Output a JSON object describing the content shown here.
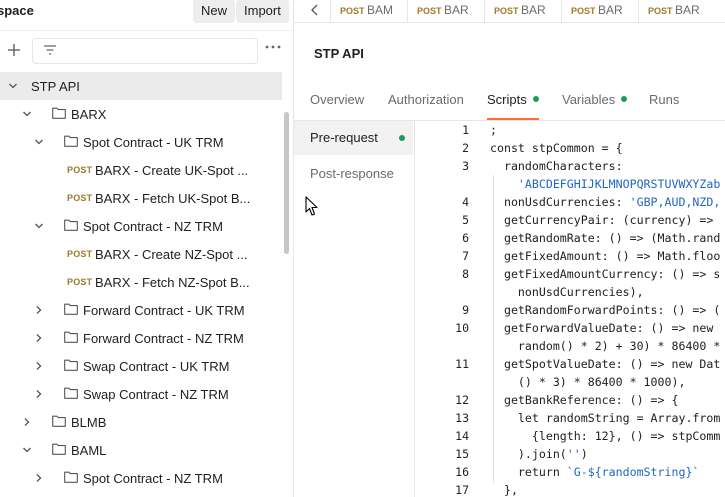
{
  "sidebar": {
    "workspace_title": "space",
    "new_label": "New",
    "import_label": "Import",
    "tree": [
      {
        "label": "STP API",
        "type": "collection",
        "expanded": true,
        "selected": true,
        "level": 0
      },
      {
        "label": "BARX",
        "type": "folder",
        "expanded": true,
        "level": 1
      },
      {
        "label": "Spot Contract - UK TRM",
        "type": "folder",
        "expanded": true,
        "level": 2
      },
      {
        "label": "BARX - Create UK-Spot ...",
        "type": "request",
        "method": "POST",
        "level": 3
      },
      {
        "label": "BARX - Fetch UK-Spot B...",
        "type": "request",
        "method": "POST",
        "level": 3
      },
      {
        "label": "Spot Contract - NZ TRM",
        "type": "folder",
        "expanded": true,
        "level": 2
      },
      {
        "label": "BARX - Create NZ-Spot ...",
        "type": "request",
        "method": "POST",
        "level": 3
      },
      {
        "label": "BARX - Fetch NZ-Spot B...",
        "type": "request",
        "method": "POST",
        "level": 3
      },
      {
        "label": "Forward Contract - UK TRM",
        "type": "folder",
        "expanded": false,
        "level": 2
      },
      {
        "label": "Forward Contract - NZ TRM",
        "type": "folder",
        "expanded": false,
        "level": 2
      },
      {
        "label": "Swap Contract - UK TRM",
        "type": "folder",
        "expanded": false,
        "level": 2
      },
      {
        "label": "Swap Contract - NZ TRM",
        "type": "folder",
        "expanded": false,
        "level": 2
      },
      {
        "label": "BLMB",
        "type": "folder",
        "expanded": false,
        "level": 1
      },
      {
        "label": "BAML",
        "type": "folder",
        "expanded": true,
        "level": 1
      },
      {
        "label": "Spot Contract - NZ TRM",
        "type": "folder",
        "expanded": false,
        "level": 2
      }
    ]
  },
  "tabs": [
    {
      "method": "POST",
      "name": "BAM"
    },
    {
      "method": "POST",
      "name": "BAR"
    },
    {
      "method": "POST",
      "name": "BAR"
    },
    {
      "method": "POST",
      "name": "BAR"
    },
    {
      "method": "POST",
      "name": "BAR"
    }
  ],
  "request": {
    "title": "STP API",
    "subtabs": [
      {
        "label": "Overview",
        "dot": false,
        "active": false
      },
      {
        "label": "Authorization",
        "dot": false,
        "active": false
      },
      {
        "label": "Scripts",
        "dot": true,
        "active": true
      },
      {
        "label": "Variables",
        "dot": true,
        "active": false
      },
      {
        "label": "Runs",
        "dot": false,
        "active": false
      }
    ],
    "script_nav": [
      {
        "label": "Pre-request",
        "dot": true,
        "active": true
      },
      {
        "label": "Post-response",
        "dot": false,
        "active": false
      }
    ]
  },
  "editor": {
    "lines": [
      {
        "n": "1",
        "text": ";"
      },
      {
        "n": "2",
        "text": "const stpCommon = {"
      },
      {
        "n": "3",
        "text": "  randomCharacters:"
      },
      {
        "n": "",
        "text": "    'ABCDEFGHIJKLMNOPQRSTUVWXYZab"
      },
      {
        "n": "4",
        "text": "  nonUsdCurrencies: 'GBP,AUD,NZD,"
      },
      {
        "n": "5",
        "text": "  getCurrencyPair: (currency) =>"
      },
      {
        "n": "6",
        "text": "  getRandomRate: () => (Math.rand"
      },
      {
        "n": "7",
        "text": "  getFixedAmount: () => Math.floo"
      },
      {
        "n": "8",
        "text": "  getFixedAmountCurrency: () => s"
      },
      {
        "n": "",
        "text": "    nonUsdCurrencies),"
      },
      {
        "n": "9",
        "text": "  getRandomForwardPoints: () => ("
      },
      {
        "n": "10",
        "text": "  getForwardValueDate: () => new"
      },
      {
        "n": "",
        "text": "    random() * 2) + 30) * 86400 *"
      },
      {
        "n": "11",
        "text": "  getSpotValueDate: () => new Dat"
      },
      {
        "n": "",
        "text": "    () * 3) * 86400 * 1000),"
      },
      {
        "n": "12",
        "text": "  getBankReference: () => {"
      },
      {
        "n": "13",
        "text": "    let randomString = Array.from"
      },
      {
        "n": "14",
        "text": "      {length: 12}, () => stpComm"
      },
      {
        "n": "15",
        "text": "    ).join('')"
      },
      {
        "n": "16",
        "text": "    return `G-${randomString}`"
      },
      {
        "n": "17",
        "text": "  },"
      }
    ]
  },
  "colors": {
    "accent": "#ff6c37",
    "dot_green": "#1c9b57",
    "post_method": "#a07a2a",
    "string": "#1f66c2"
  }
}
